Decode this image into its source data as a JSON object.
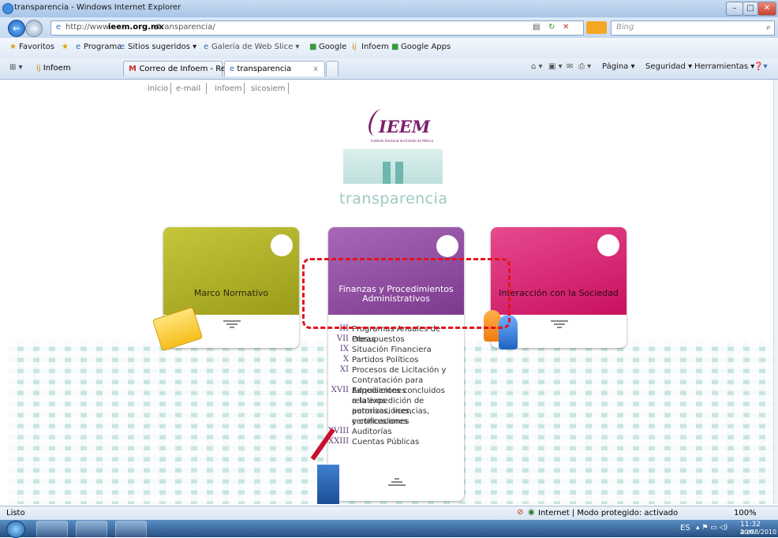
{
  "window": {
    "title": "transparencia - Windows Internet Explorer"
  },
  "address": {
    "url_prefix": "http://www.",
    "url_domain": "ieem.org.mx",
    "url_suffix": "/transparencia/",
    "search_placeholder": "Bing"
  },
  "favorites": {
    "items": [
      "Favoritos",
      "Programa",
      "Sitios sugeridos ▾",
      "Galería de Web Slice ▾",
      "Google",
      "Infoem",
      "Google Apps"
    ]
  },
  "tabs": [
    {
      "label": "Infoem"
    },
    {
      "label": "Correo de Infoem - Recibi..."
    },
    {
      "label": "transparencia"
    }
  ],
  "commandbar": {
    "items": [
      "Página ▾",
      "Seguridad ▾",
      "Herramientas ▾"
    ]
  },
  "toplinks": [
    "inicio",
    "e-mail",
    "infoem",
    "sicosiem"
  ],
  "logo": {
    "name": "IEEM",
    "subtitle": "Instituto Electoral del Estado de México"
  },
  "transparency_word": "transparencia",
  "cards": [
    {
      "title": "Marco Normativo",
      "color": "#a8aa22"
    },
    {
      "title_line1": "Finanzas y Procedimientos",
      "title_line2": "Administrativos",
      "color": "#8e4a9f"
    },
    {
      "title": "Interacción con la Sociedad",
      "color": "#d21e72"
    }
  ],
  "finanzas_items": [
    {
      "roman": "III",
      "lines": [
        "Programas Anuales de Obras"
      ]
    },
    {
      "roman": "VII",
      "lines": [
        "Presupuestos"
      ]
    },
    {
      "roman": "IX",
      "lines": [
        "Situación Financiera"
      ]
    },
    {
      "roman": "X",
      "lines": [
        "Partidos Políticos"
      ]
    },
    {
      "roman": "XI",
      "lines": [
        "Procesos de Licitación y",
        "Contratación para Adquisiciones"
      ]
    },
    {
      "roman": "XVII",
      "lines": [
        "Expedientes concluidos relativos",
        "a la expedición de autorizaciones,",
        "permisos, licencias, certificaciones",
        "y concesiones"
      ]
    },
    {
      "roman": "XVIII",
      "lines": [
        "Auditorías"
      ]
    },
    {
      "roman": "XXIII",
      "lines": [
        "Cuentas Públicas"
      ]
    }
  ],
  "status": {
    "left": "Listo",
    "zone": "Internet | Modo protegido: activado",
    "zoom": "100%"
  },
  "taskbar": {
    "lang": "ES",
    "time": "11:32 a.m.",
    "date": "20/08/2010"
  }
}
